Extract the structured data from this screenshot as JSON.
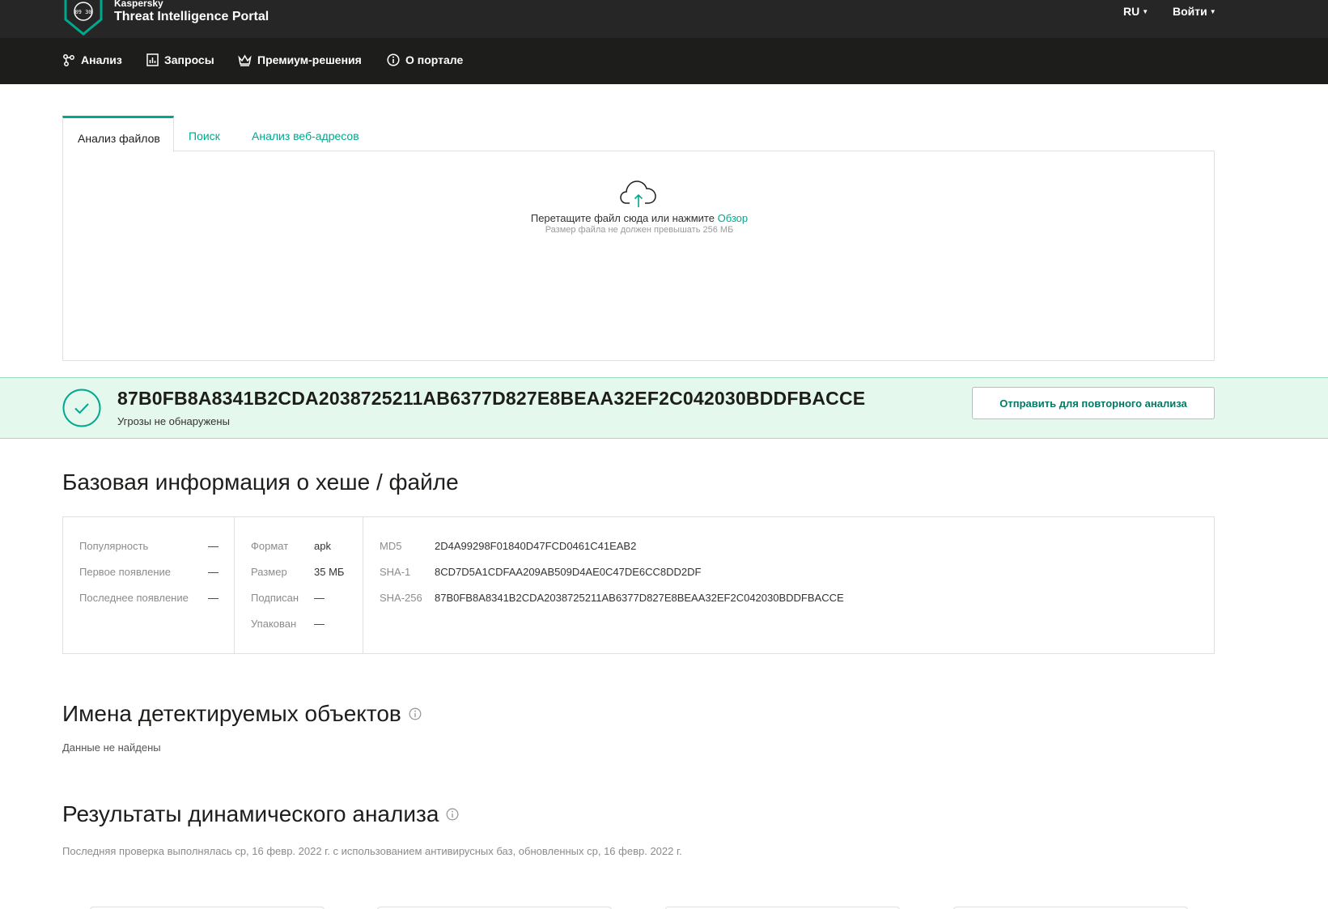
{
  "header": {
    "brand_small": "Kaspersky",
    "brand_title": "Threat Intelligence Portal",
    "lang": "RU",
    "login": "Войти"
  },
  "nav": {
    "items": [
      {
        "label": "Анализ",
        "icon": "analysis-icon"
      },
      {
        "label": "Запросы",
        "icon": "chart-icon"
      },
      {
        "label": "Премиум-решения",
        "icon": "crown-icon"
      },
      {
        "label": "О портале",
        "icon": "info-icon"
      }
    ]
  },
  "tabs": [
    {
      "label": "Анализ файлов",
      "active": true
    },
    {
      "label": "Поиск",
      "active": false
    },
    {
      "label": "Анализ веб-адресов",
      "active": false
    }
  ],
  "upload": {
    "text": "Перетащите файл сюда или нажмите",
    "browse": "Обзор",
    "hint": "Размер файла не должен превышать 256 МБ"
  },
  "result": {
    "hash": "87B0FB8A8341B2CDA2038725211AB6377D827E8BEAA32EF2C042030BDDFBACCE",
    "status": "Угрозы не обнаружены",
    "resubmit": "Отправить для повторного анализа",
    "status_color": "#00a88e"
  },
  "basic_info": {
    "title": "Базовая информация о хеше / файле",
    "col1": [
      {
        "label": "Популярность",
        "value": "—"
      },
      {
        "label": "Первое появление",
        "value": "—"
      },
      {
        "label": "Последнее появление",
        "value": "—"
      }
    ],
    "col2": [
      {
        "label": "Формат",
        "value": "apk"
      },
      {
        "label": "Размер",
        "value": "35 МБ"
      },
      {
        "label": "Подписан",
        "value": "—"
      },
      {
        "label": "Упакован",
        "value": "—"
      }
    ],
    "col3": [
      {
        "label": "MD5",
        "value": "2D4A99298F01840D47FCD0461C41EAB2"
      },
      {
        "label": "SHA-1",
        "value": "8CD7D5A1CDFAA209AB509D4AE0C47DE6CC8DD2DF"
      },
      {
        "label": "SHA-256",
        "value": "87B0FB8A8341B2CDA2038725211AB6377D827E8BEAA32EF2C042030BDDFBACCE"
      }
    ]
  },
  "detections": {
    "title": "Имена детектируемых объектов",
    "empty": "Данные не найдены"
  },
  "dynamic": {
    "title": "Результаты динамического анализа",
    "last_check": "Последняя проверка выполнялась ср, 16 февр. 2022 г. с использованием антивирусных баз, обновленных ср, 16 февр. 2022 г."
  },
  "colors": {
    "accent": "#00a88e",
    "topbar": "#262626",
    "navbar": "#1d1d1b",
    "banner_bg": "#e4f8ee"
  }
}
